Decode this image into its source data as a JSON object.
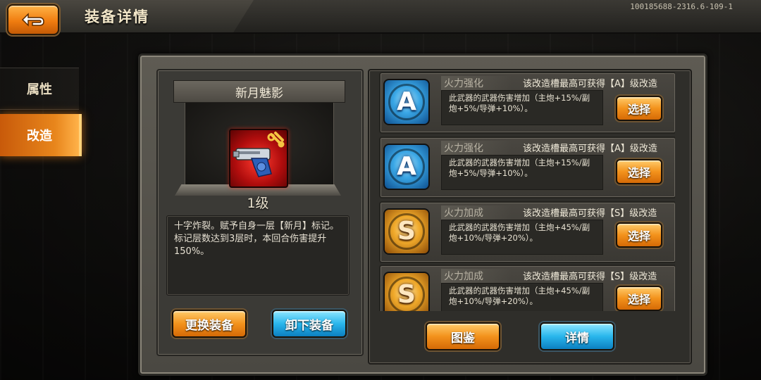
{
  "header": {
    "title": "装备详情",
    "build_id": "100185688-2316.6-109-1"
  },
  "sidebar": {
    "items": [
      {
        "label": "属性",
        "active": false
      },
      {
        "label": "改造",
        "active": true
      }
    ]
  },
  "weapon": {
    "name": "新月魅影",
    "level": "1级",
    "description": "十字炸裂。赋予自身一层【新月】标记。标记层数达到3层时，本回合伤害提升150%。"
  },
  "left_buttons": {
    "change": "更换装备",
    "unequip": "卸下装备"
  },
  "slots": [
    {
      "grade": "A",
      "type": "火力强化",
      "hint": "该改造槽最高可获得【A】级改造",
      "desc": "此武器的武器伤害增加（主炮+15%/副炮+5%/导弹+10%）。",
      "button": "选择"
    },
    {
      "grade": "A",
      "type": "火力强化",
      "hint": "该改造槽最高可获得【A】级改造",
      "desc": "此武器的武器伤害增加（主炮+15%/副炮+5%/导弹+10%）。",
      "button": "选择"
    },
    {
      "grade": "S",
      "type": "火力加成",
      "hint": "该改造槽最高可获得【S】级改造",
      "desc": "此武器的武器伤害增加（主炮+45%/副炮+10%/导弹+20%）。",
      "button": "选择"
    },
    {
      "grade": "S",
      "type": "火力加成",
      "hint": "该改造槽最高可获得【S】级改造",
      "desc": "此武器的武器伤害增加（主炮+45%/副炮+10%/导弹+20%）。",
      "button": "选择"
    }
  ],
  "bottom_buttons": {
    "codex": "图鉴",
    "details": "详情"
  },
  "colors": {
    "accent_orange": "#f3921c",
    "accent_blue": "#29b6ec",
    "panel": "#3b3a36"
  }
}
